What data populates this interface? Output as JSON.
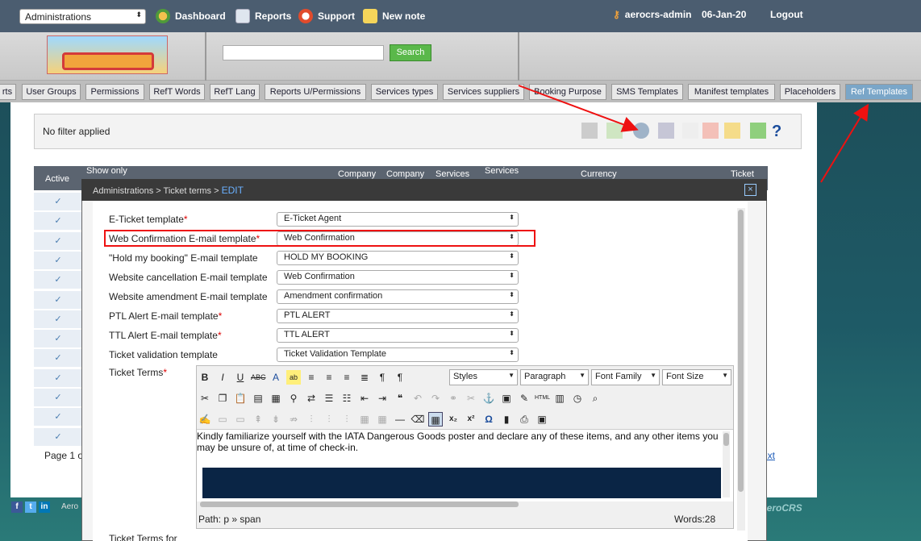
{
  "topbar": {
    "admin_select": "Administrations",
    "nav": [
      "Dashboard",
      "Reports",
      "Support",
      "New note"
    ],
    "user": "aerocrs-admin",
    "date": "06-Jan-20",
    "logout": "Logout"
  },
  "search": {
    "button": "Search",
    "placeholder": ""
  },
  "tabs": [
    "rts",
    "User Groups",
    "Permissions",
    "RefT Words",
    "RefT Lang",
    "Reports U/Permissions",
    "Services types",
    "Services suppliers",
    "Booking Purpose",
    "SMS Templates",
    "Manifest templates",
    "Placeholders",
    "Ref Templates"
  ],
  "filter": {
    "text": "No filter applied"
  },
  "grid": {
    "active_header": "Active",
    "show_only": "Show only",
    "col_company": "Company",
    "col_company2": "Company",
    "col_services": "Services",
    "col_services2": "Services",
    "col_currency": "Currency",
    "col_ticket": "Ticket",
    "rows": 13,
    "pager": "Page 1 o",
    "next": "ext"
  },
  "footer": {
    "aero": "Aero",
    "logo": "aeroCRS"
  },
  "modal": {
    "breadcrumb": "Administrations > Ticket terms > ",
    "edit": "EDIT",
    "close": "×",
    "fields": [
      {
        "label": "E-Ticket template",
        "required": "*",
        "value": "E-Ticket Agent"
      },
      {
        "label": "Web Confirmation E-mail template",
        "required": "*",
        "value": "Web Confirmation"
      },
      {
        "label": "\"Hold my booking\" E-mail template",
        "required": "",
        "value": "HOLD MY BOOKING"
      },
      {
        "label": "Website cancellation E-mail template",
        "required": "",
        "value": "Web Confirmation"
      },
      {
        "label": "Website amendment E-mail template",
        "required": "",
        "value": "Amendment confirmation"
      },
      {
        "label": "PTL Alert E-mail template",
        "required": "*",
        "value": "PTL ALERT"
      },
      {
        "label": "TTL Alert E-mail template",
        "required": "*",
        "value": "TTL ALERT"
      },
      {
        "label": "Ticket validation template",
        "required": "",
        "value": "Ticket Validation Template"
      }
    ],
    "ticket_terms_label": "Ticket Terms",
    "ticket_terms_req": "*",
    "ticket_terms_for": "Ticket Terms for"
  },
  "editor": {
    "styles": "Styles",
    "paragraph": "Paragraph",
    "font_family": "Font Family",
    "font_size": "Font Size",
    "content": "Kindly familiarize yourself with the IATA Dangerous Goods poster and declare any of these items, and any other items you may be unsure of, at time of check-in.",
    "path": "Path: p » span",
    "words": "Words:28"
  }
}
